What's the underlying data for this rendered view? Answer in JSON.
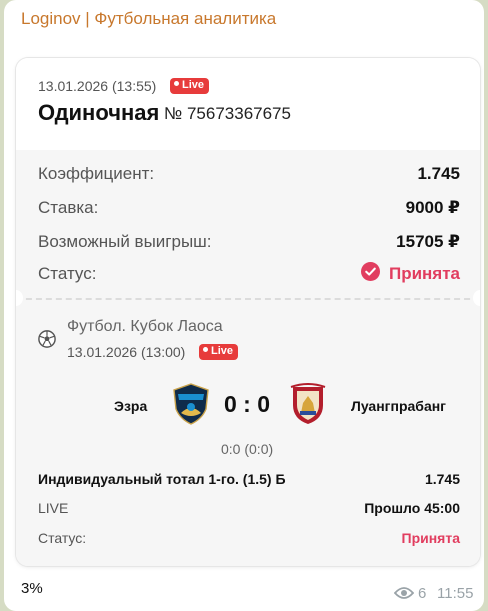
{
  "channel": {
    "title": "Loginov | Футбольная аналитика"
  },
  "ticket": {
    "datetime": "13.01.2026 (13:55)",
    "live_badge": "Live",
    "type": "Одиночная",
    "number": "№ 75673367675",
    "rows": [
      {
        "label": "Коэффициент:",
        "value": "1.745"
      },
      {
        "label": "Ставка:",
        "value": "9000 ₽"
      },
      {
        "label": "Возможный выигрыш:",
        "value": "15705 ₽"
      },
      {
        "label": "Статус:",
        "value": "Принята"
      }
    ]
  },
  "event": {
    "league": "Футбол. Кубок Лаоса",
    "datetime": "13.01.2026 (13:00)",
    "live_badge": "Live",
    "team_home": "Эзра",
    "team_away": "Луангпрабанг",
    "score": "0 : 0",
    "halftime": "0:0 (0:0)",
    "market": "Индивидуальный тотал 1-го. (1.5) Б",
    "market_odds": "1.745",
    "live_label": "LIVE",
    "elapsed": "Прошло 45:00",
    "status_label": "Статус:",
    "status_value": "Принята"
  },
  "message": {
    "text": "3%",
    "views": "6",
    "time": "11:55"
  },
  "colors": {
    "accent": "#e13d5f",
    "live": "#e73b3b",
    "channel": "#c8782d"
  },
  "icons": [
    "check-circle-icon",
    "football-icon",
    "eye-icon"
  ]
}
